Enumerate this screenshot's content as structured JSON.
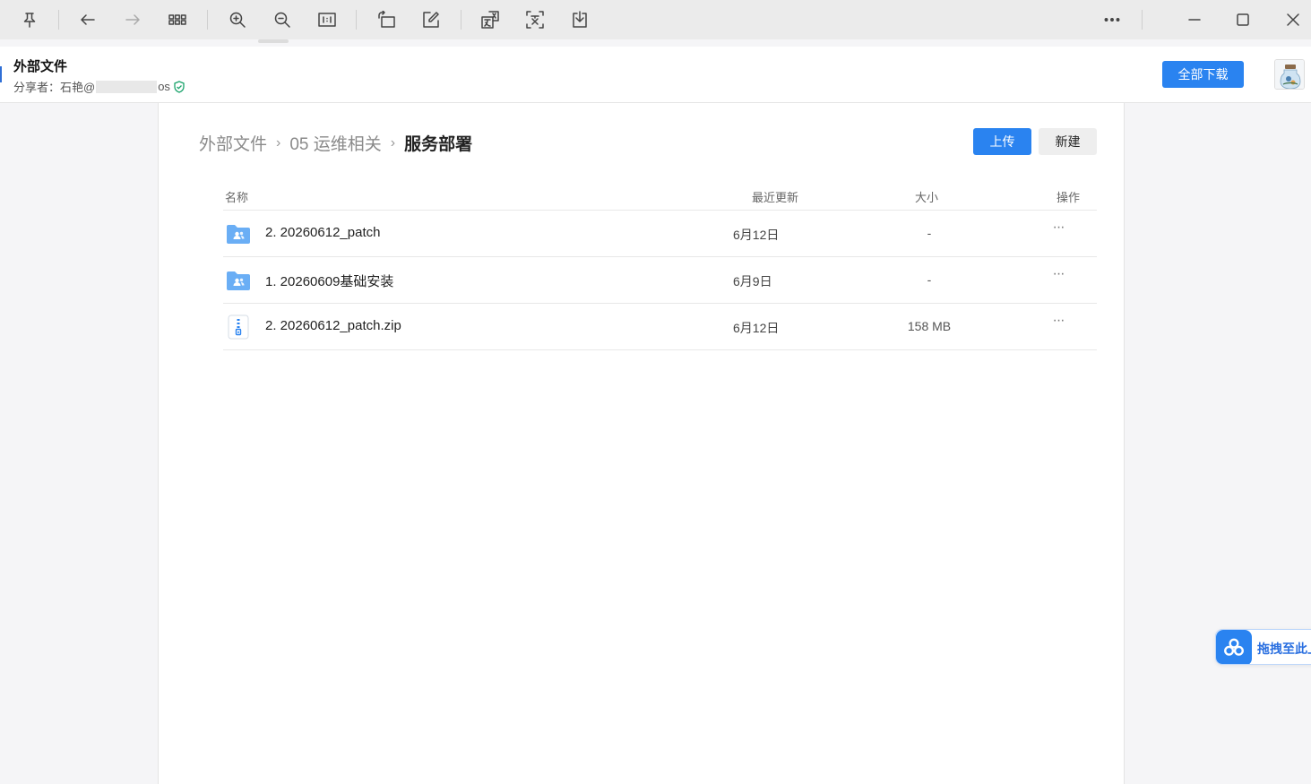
{
  "toolbar": {
    "icons": [
      "pin-icon",
      "back-arrow-icon",
      "forward-arrow-icon",
      "grid-view-icon",
      "zoom-in-icon",
      "zoom-out-icon",
      "actual-size-icon",
      "rotate-icon",
      "edit-icon",
      "translate-icon",
      "text-recognition-icon",
      "download-icon",
      "more-icon",
      "minimize-icon",
      "maximize-icon",
      "close-icon"
    ]
  },
  "share": {
    "title": "外部文件",
    "sharer_prefix": "分享者：石艳@",
    "sharer_suffix": "os",
    "download_all_label": "全部下载"
  },
  "breadcrumb": {
    "items": [
      "外部文件",
      "05 运维相关"
    ],
    "separator": "›",
    "current": "服务部署"
  },
  "actions": {
    "upload_label": "上传",
    "new_label": "新建"
  },
  "table": {
    "headers": {
      "name": "名称",
      "updated": "最近更新",
      "size": "大小",
      "actions": "操作"
    },
    "rows": [
      {
        "icon": "shared-folder-icon",
        "name": "2. 20260612_patch",
        "updated": "6月12日",
        "size": "-",
        "more": "···"
      },
      {
        "icon": "shared-folder-icon",
        "name": "1. 20260609基础安装",
        "updated": "6月9日",
        "size": "-",
        "more": "···"
      },
      {
        "icon": "zip-file-icon",
        "name": "2. 20260612_patch.zip",
        "updated": "6月12日",
        "size": "158 MB",
        "more": "···"
      }
    ]
  },
  "drag_widget": {
    "label": "拖拽至此上"
  },
  "colors": {
    "accent": "#2a83f0",
    "folder": "#6aaef5",
    "verified": "#1aa36b"
  }
}
